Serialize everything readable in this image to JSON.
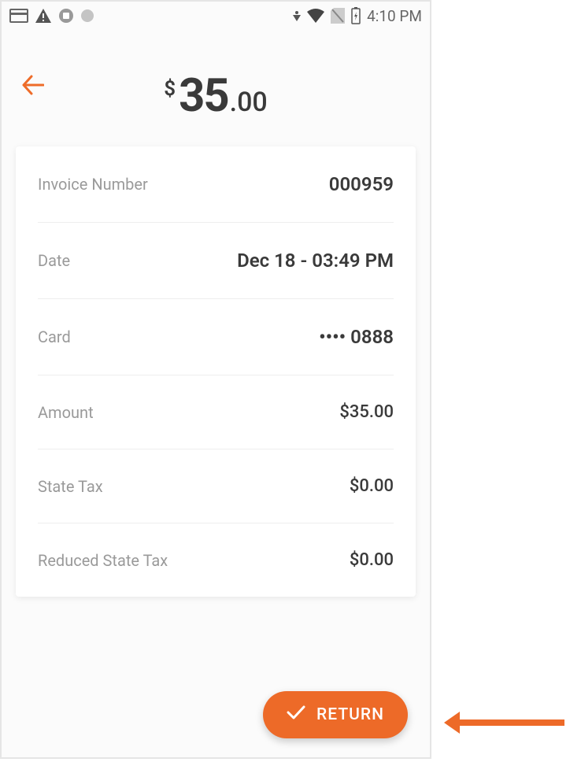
{
  "status_bar": {
    "time": "4:10 PM"
  },
  "header": {
    "currency_symbol": "$",
    "amount_whole": "35",
    "amount_cents": ".00"
  },
  "details": {
    "invoice_number": {
      "label": "Invoice Number",
      "value": "000959"
    },
    "date": {
      "label": "Date",
      "value": "Dec 18 - 03:49 PM"
    },
    "card": {
      "label": "Card",
      "value": "•••• 0888"
    },
    "amount": {
      "label": "Amount",
      "value": "$35.00"
    },
    "state_tax": {
      "label": "State Tax",
      "value": "$0.00"
    },
    "reduced_state_tax": {
      "label": "Reduced State Tax",
      "value": "$0.00"
    }
  },
  "return_button": {
    "label": "RETURN"
  },
  "colors": {
    "accent": "#ed6a28"
  }
}
